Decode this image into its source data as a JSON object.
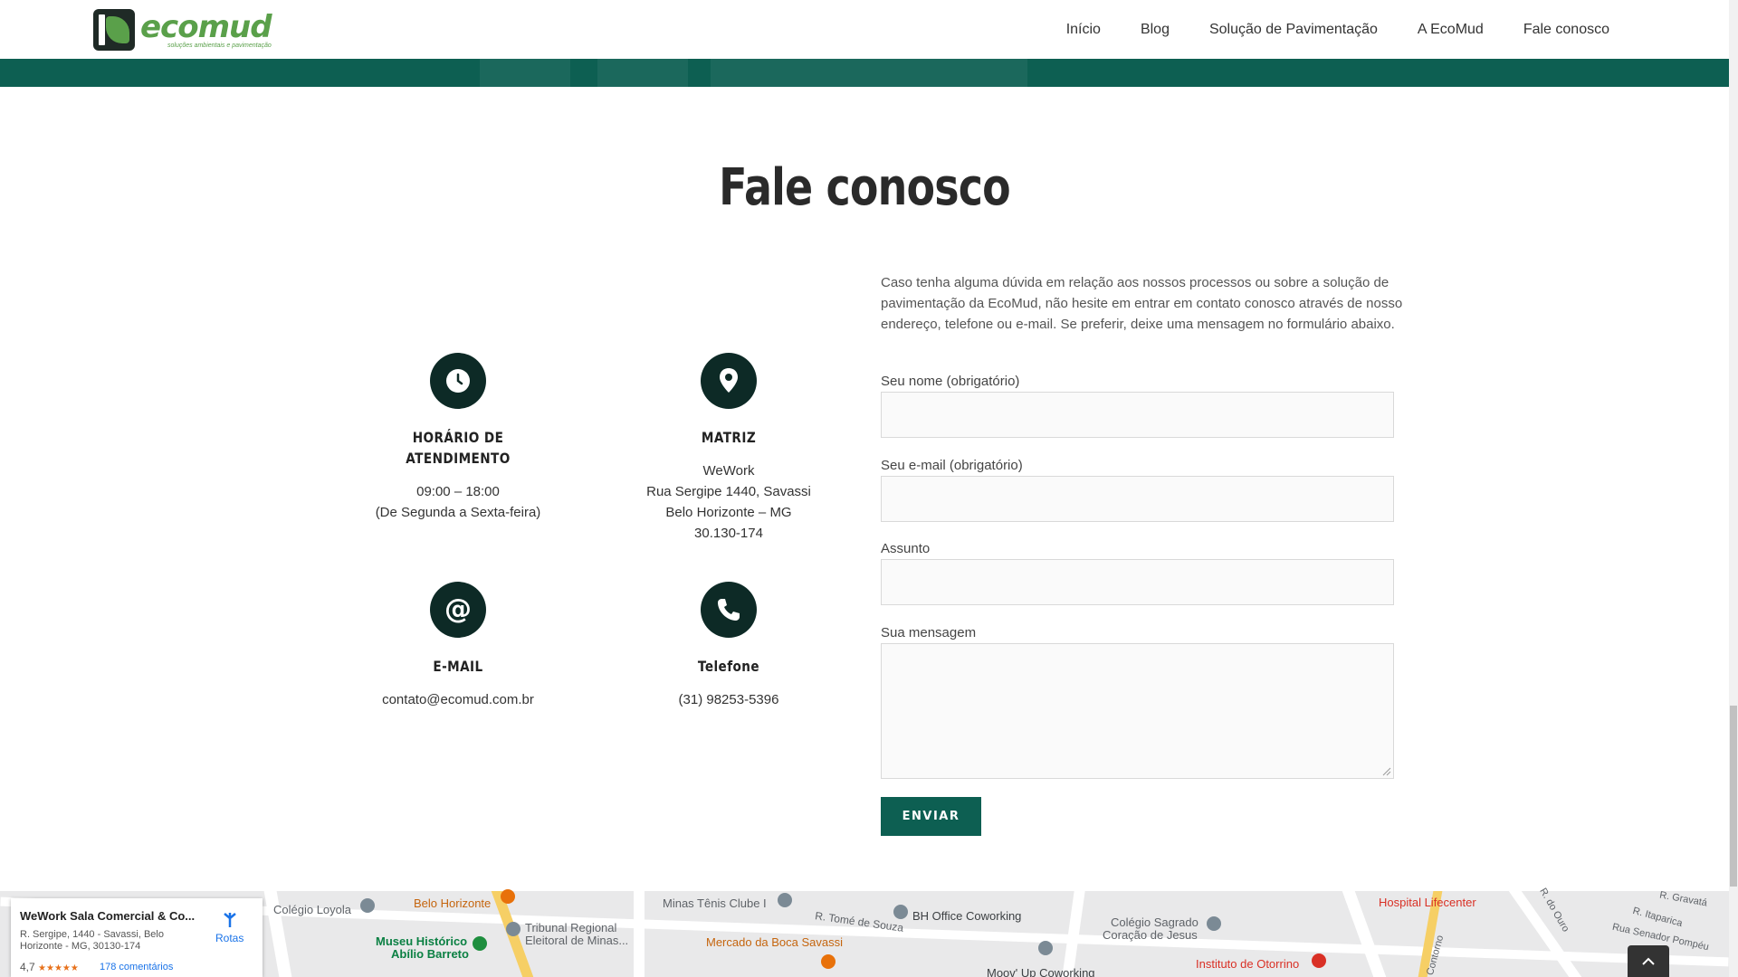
{
  "brand": {
    "name": "ecomud",
    "tagline": "soluções ambientais e pavimentação",
    "accent": "#0d5f52",
    "green": "#5aa04a",
    "dark_icon": "#0d2a26"
  },
  "nav": {
    "items": [
      "Início",
      "Blog",
      "Solução de Pavimentação",
      "A EcoMud",
      "Fale conosco"
    ]
  },
  "page": {
    "title": "Fale conosco"
  },
  "contact_info": {
    "hours": {
      "icon": "clock-icon",
      "title": "HORÁRIO DE ATENDIMENTO",
      "line1": "09:00 – 18:00",
      "line2": "(De Segunda a Sexta-feira)"
    },
    "hq": {
      "icon": "map-pin-icon",
      "title": "MATRIZ",
      "line1": "WeWork",
      "line2": "Rua Sergipe 1440, Savassi",
      "line3": "Belo Horizonte – MG",
      "line4": "30.130-174"
    },
    "email": {
      "icon": "at-icon",
      "title": "E-MAIL",
      "value": "contato@ecomud.com.br"
    },
    "phone": {
      "icon": "phone-icon",
      "title": "Telefone",
      "value": "(31) 98253-5396"
    }
  },
  "form": {
    "intro": "Caso tenha alguma dúvida em relação aos nossos processos ou sobre a solução de pavimentação da EcoMud, não hesite em entrar em contato conosco através de nosso endereço, telefone ou e-mail. Se preferir, deixe uma mensagem no formulário abaixo.",
    "name_label": "Seu nome (obrigatório)",
    "email_label": "Seu e-mail (obrigatório)",
    "subject_label": "Assunto",
    "message_label": "Sua mensagem",
    "submit_label": "ENVIAR"
  },
  "map": {
    "place_name": "WeWork Sala Comercial & Co...",
    "place_address": "R. Sergipe, 1440 - Savassi, Belo Horizonte - MG, 30130-174",
    "rating": "4,7",
    "reviews": "178 comentários",
    "routes_label": "Rotas",
    "labels": {
      "colegio_loyola": "Colégio Loyola",
      "hotel_bh": "Belo Horizonte",
      "minas_tenis": "Minas Tênis Clube I",
      "rua_tome": "R. Tomé de Souza",
      "bh_office": "BH Office Coworking",
      "colegio_sagrado": "Colégio Sagrado",
      "coracao": "Coração de Jesus",
      "hospital": "Hospital Lifecenter",
      "itaparica": "R. Itaparica",
      "gravata": "R. Gravatá",
      "senador": "Rua Senador Pompéu",
      "museu1": "Museu Histórico",
      "museu2": "Abílio Barreto",
      "tribunal1": "Tribunal Regional",
      "tribunal2": "Eleitoral de Minas...",
      "mercado": "Mercado da Boca Savassi",
      "instituto": "Instituto de Otorrino",
      "moov": "Moov' Up Coworking",
      "contorno": "Contorno",
      "rua_ouro": "R. do Ouro"
    }
  }
}
